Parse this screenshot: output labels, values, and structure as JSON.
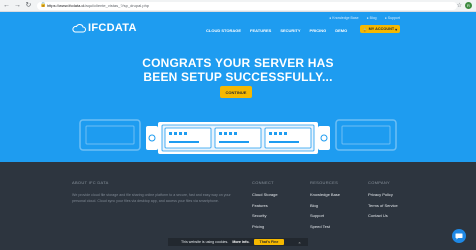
{
  "browser": {
    "url_domain": "https://www.ifcdata.cl",
    "url_path": "/aqui/cliente_vistas_?/sp_drupal.php",
    "profile_initial": "R"
  },
  "topbar": {
    "knowledge": "Knowledge Base",
    "blog": "Blog",
    "support": "Support"
  },
  "logo": {
    "text": "IFCDATA"
  },
  "menu": {
    "cloud_storage": "CLOUD STORAGE",
    "features": "FEATURES",
    "security": "SECURITY",
    "pricing": "PRICING",
    "demo": "DEMO",
    "account": "MY ACCOUNT"
  },
  "hero": {
    "headline_line1": "CONGRATS YOUR SERVER HAS",
    "headline_line2": "BEEN SETUP SUCCESSFULLY...",
    "cta": "CONTINUE"
  },
  "footer": {
    "about_title": "ABOUT IFC DATA",
    "about_text": "We provide cloud file storage and file sharing online platform to a secure, fast and easy way on your personal cloud. Cloud sync your files via desktop app, and access your files via smartphone.",
    "connect": {
      "title": "CONNECT",
      "links": [
        "Cloud Storage",
        "Features",
        "Security",
        "Pricing"
      ]
    },
    "resources": {
      "title": "RESOURCES",
      "links": [
        "Knowledge Base",
        "Blog",
        "Support",
        "Speed Test"
      ]
    },
    "company": {
      "title": "COMPANY",
      "links": [
        "Privacy Policy",
        "Terms of Service",
        "Contact Us"
      ]
    }
  },
  "cookie": {
    "message": "This website is using cookies.",
    "more_info": "More info.",
    "accept": "That's Fine",
    "close": "×"
  },
  "colors": {
    "hero_bg": "#1e9cf0",
    "accent": "#f5b800",
    "footer_bg": "#2d353f"
  }
}
